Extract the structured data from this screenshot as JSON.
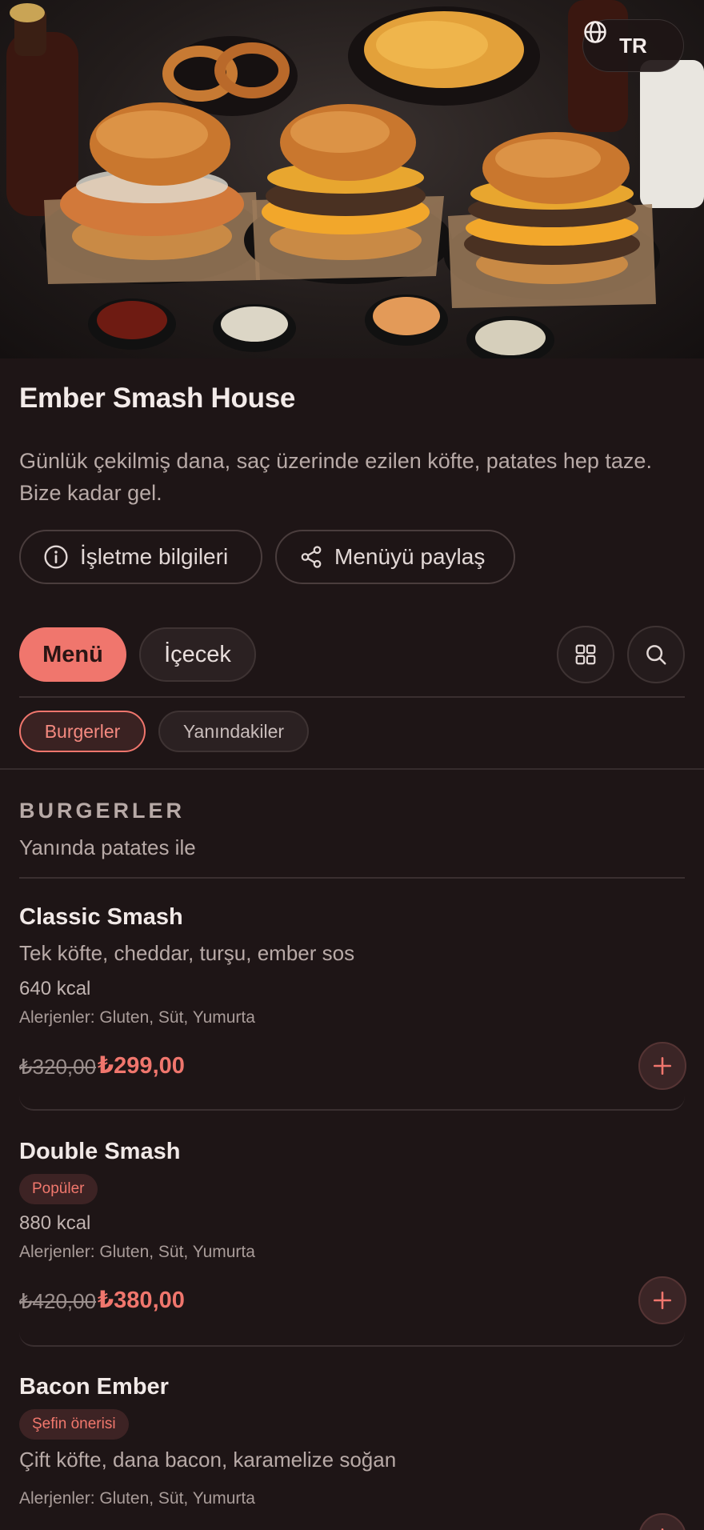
{
  "header": {
    "language": "TR",
    "language_icon": "globe-icon"
  },
  "restaurant": {
    "name": "Ember Smash House",
    "description": "Günlük çekilmiş dana, saç üzerinde ezilen köfte, patates hep taze. Bize kadar gel.",
    "info_button": "İşletme bilgileri",
    "share_button": "Menüyü paylaş"
  },
  "tabs": [
    {
      "label": "Menü",
      "active": true
    },
    {
      "label": "İçecek",
      "active": false
    }
  ],
  "categories": [
    {
      "label": "Burgerler",
      "active": true
    },
    {
      "label": "Yanındakiler",
      "active": false
    }
  ],
  "section": {
    "title": "BURGERLER",
    "subtitle": "Yanında patates ile"
  },
  "items": [
    {
      "name": "Classic Smash",
      "description": "Tek köfte, cheddar, turşu, ember sos",
      "kcal": "640 kcal",
      "allergens": "Alerjenler: Gluten, Süt, Yumurta",
      "old_price": "₺320,00",
      "price": "₺299,00"
    },
    {
      "name": "Double Smash",
      "badge": "Popüler",
      "kcal": "880 kcal",
      "allergens": "Alerjenler: Gluten, Süt, Yumurta",
      "old_price": "₺420,00",
      "price": "₺380,00"
    },
    {
      "name": "Bacon Ember",
      "badge": "Şefin önerisi",
      "description": "Çift köfte, dana bacon, karamelize soğan",
      "allergens": "Alerjenler: Gluten, Süt, Yumurta"
    }
  ],
  "colors": {
    "accent": "#f0766d",
    "background": "#1e1516"
  }
}
